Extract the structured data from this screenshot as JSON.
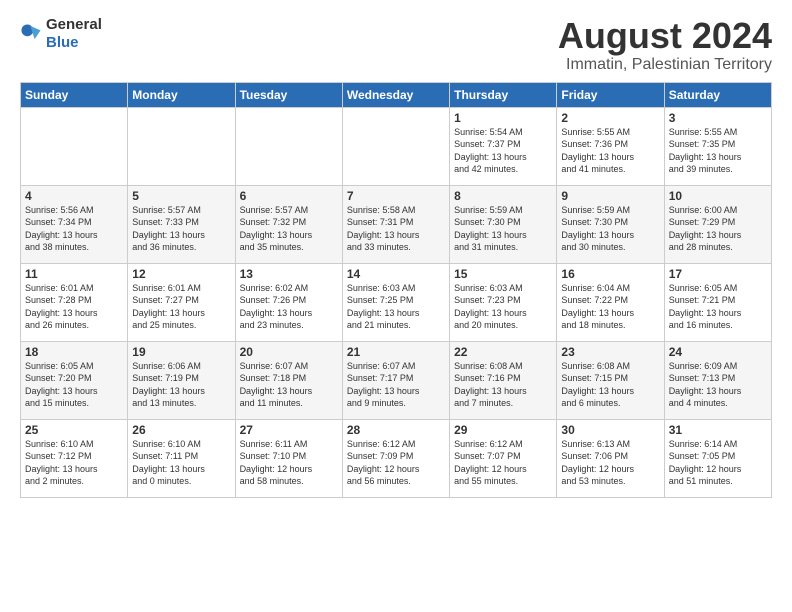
{
  "logo": {
    "general": "General",
    "blue": "Blue"
  },
  "title": "August 2024",
  "subtitle": "Immatin, Palestinian Territory",
  "days_of_week": [
    "Sunday",
    "Monday",
    "Tuesday",
    "Wednesday",
    "Thursday",
    "Friday",
    "Saturday"
  ],
  "weeks": [
    [
      {
        "day": "",
        "info": ""
      },
      {
        "day": "",
        "info": ""
      },
      {
        "day": "",
        "info": ""
      },
      {
        "day": "",
        "info": ""
      },
      {
        "day": "1",
        "info": "Sunrise: 5:54 AM\nSunset: 7:37 PM\nDaylight: 13 hours\nand 42 minutes."
      },
      {
        "day": "2",
        "info": "Sunrise: 5:55 AM\nSunset: 7:36 PM\nDaylight: 13 hours\nand 41 minutes."
      },
      {
        "day": "3",
        "info": "Sunrise: 5:55 AM\nSunset: 7:35 PM\nDaylight: 13 hours\nand 39 minutes."
      }
    ],
    [
      {
        "day": "4",
        "info": "Sunrise: 5:56 AM\nSunset: 7:34 PM\nDaylight: 13 hours\nand 38 minutes."
      },
      {
        "day": "5",
        "info": "Sunrise: 5:57 AM\nSunset: 7:33 PM\nDaylight: 13 hours\nand 36 minutes."
      },
      {
        "day": "6",
        "info": "Sunrise: 5:57 AM\nSunset: 7:32 PM\nDaylight: 13 hours\nand 35 minutes."
      },
      {
        "day": "7",
        "info": "Sunrise: 5:58 AM\nSunset: 7:31 PM\nDaylight: 13 hours\nand 33 minutes."
      },
      {
        "day": "8",
        "info": "Sunrise: 5:59 AM\nSunset: 7:30 PM\nDaylight: 13 hours\nand 31 minutes."
      },
      {
        "day": "9",
        "info": "Sunrise: 5:59 AM\nSunset: 7:30 PM\nDaylight: 13 hours\nand 30 minutes."
      },
      {
        "day": "10",
        "info": "Sunrise: 6:00 AM\nSunset: 7:29 PM\nDaylight: 13 hours\nand 28 minutes."
      }
    ],
    [
      {
        "day": "11",
        "info": "Sunrise: 6:01 AM\nSunset: 7:28 PM\nDaylight: 13 hours\nand 26 minutes."
      },
      {
        "day": "12",
        "info": "Sunrise: 6:01 AM\nSunset: 7:27 PM\nDaylight: 13 hours\nand 25 minutes."
      },
      {
        "day": "13",
        "info": "Sunrise: 6:02 AM\nSunset: 7:26 PM\nDaylight: 13 hours\nand 23 minutes."
      },
      {
        "day": "14",
        "info": "Sunrise: 6:03 AM\nSunset: 7:25 PM\nDaylight: 13 hours\nand 21 minutes."
      },
      {
        "day": "15",
        "info": "Sunrise: 6:03 AM\nSunset: 7:23 PM\nDaylight: 13 hours\nand 20 minutes."
      },
      {
        "day": "16",
        "info": "Sunrise: 6:04 AM\nSunset: 7:22 PM\nDaylight: 13 hours\nand 18 minutes."
      },
      {
        "day": "17",
        "info": "Sunrise: 6:05 AM\nSunset: 7:21 PM\nDaylight: 13 hours\nand 16 minutes."
      }
    ],
    [
      {
        "day": "18",
        "info": "Sunrise: 6:05 AM\nSunset: 7:20 PM\nDaylight: 13 hours\nand 15 minutes."
      },
      {
        "day": "19",
        "info": "Sunrise: 6:06 AM\nSunset: 7:19 PM\nDaylight: 13 hours\nand 13 minutes."
      },
      {
        "day": "20",
        "info": "Sunrise: 6:07 AM\nSunset: 7:18 PM\nDaylight: 13 hours\nand 11 minutes."
      },
      {
        "day": "21",
        "info": "Sunrise: 6:07 AM\nSunset: 7:17 PM\nDaylight: 13 hours\nand 9 minutes."
      },
      {
        "day": "22",
        "info": "Sunrise: 6:08 AM\nSunset: 7:16 PM\nDaylight: 13 hours\nand 7 minutes."
      },
      {
        "day": "23",
        "info": "Sunrise: 6:08 AM\nSunset: 7:15 PM\nDaylight: 13 hours\nand 6 minutes."
      },
      {
        "day": "24",
        "info": "Sunrise: 6:09 AM\nSunset: 7:13 PM\nDaylight: 13 hours\nand 4 minutes."
      }
    ],
    [
      {
        "day": "25",
        "info": "Sunrise: 6:10 AM\nSunset: 7:12 PM\nDaylight: 13 hours\nand 2 minutes."
      },
      {
        "day": "26",
        "info": "Sunrise: 6:10 AM\nSunset: 7:11 PM\nDaylight: 13 hours\nand 0 minutes."
      },
      {
        "day": "27",
        "info": "Sunrise: 6:11 AM\nSunset: 7:10 PM\nDaylight: 12 hours\nand 58 minutes."
      },
      {
        "day": "28",
        "info": "Sunrise: 6:12 AM\nSunset: 7:09 PM\nDaylight: 12 hours\nand 56 minutes."
      },
      {
        "day": "29",
        "info": "Sunrise: 6:12 AM\nSunset: 7:07 PM\nDaylight: 12 hours\nand 55 minutes."
      },
      {
        "day": "30",
        "info": "Sunrise: 6:13 AM\nSunset: 7:06 PM\nDaylight: 12 hours\nand 53 minutes."
      },
      {
        "day": "31",
        "info": "Sunrise: 6:14 AM\nSunset: 7:05 PM\nDaylight: 12 hours\nand 51 minutes."
      }
    ]
  ]
}
